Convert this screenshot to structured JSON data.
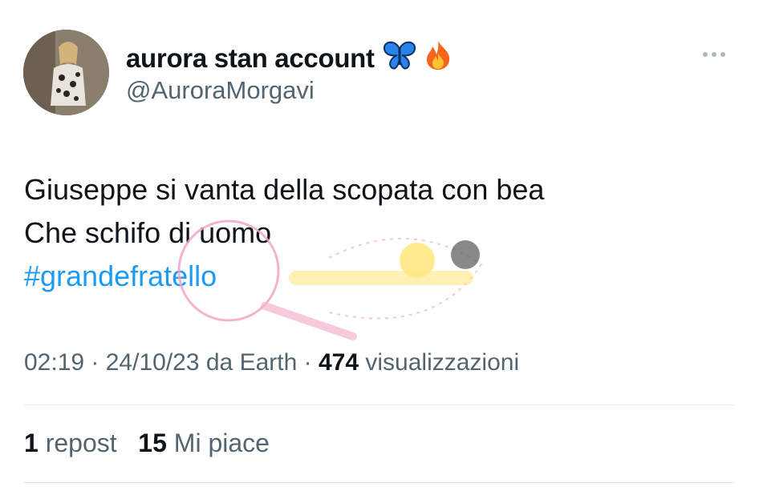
{
  "author": {
    "display_name": "aurora stan account",
    "handle": "@AuroraMorgavi",
    "name_emojis": [
      "butterfly-icon",
      "fire-icon"
    ]
  },
  "tweet": {
    "line1": "Giuseppe si vanta della scopata con bea",
    "line2": "Che schifo di uomo",
    "hashtag": "#grandefratello"
  },
  "meta": {
    "time": "02:19",
    "date": "24/10/23",
    "source": "da Earth",
    "views_count": "474",
    "views_label": "visualizzazioni"
  },
  "stats": {
    "reposts_count": "1",
    "reposts_label": "repost",
    "likes_count": "15",
    "likes_label": "Mi piace"
  },
  "colors": {
    "link": "#1d9bf0",
    "secondary_text": "#536471"
  }
}
